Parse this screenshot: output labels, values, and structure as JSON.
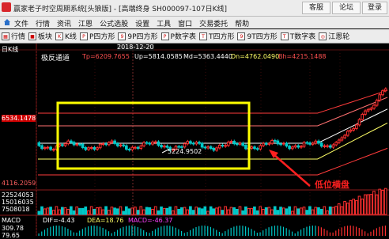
{
  "window": {
    "title": "赢家老子时空周期系统[头狼版] - [高端终身 SH000097-107日K线]",
    "buttons": [
      "客服",
      "论坛",
      "登录"
    ]
  },
  "menu": [
    "文件",
    "行情",
    "资讯",
    "江恩",
    "公式选股",
    "设置",
    "工具",
    "窗口",
    "交易委托",
    "帮助"
  ],
  "toolbar": [
    "行情",
    "板块",
    "K线",
    "P四方形",
    "9P四方形",
    "P数字表",
    "T四方形",
    "9T四方形",
    "T数字表",
    "江恩轮"
  ],
  "panel": {
    "label": "日K线",
    "indicator_name": "极反通道",
    "tp": "Tp=6209.7655",
    "up": "Up=5814.0585",
    "md": "Md=5363.4440",
    "dn": "Dn=4762.0490",
    "bh": "Bh=4215.1488",
    "date_marker": "2018-12-20",
    "price_left_high": "6534.1478",
    "price_left_low": "4116.2059",
    "point_label": "5224.9502",
    "annotation": "低位横盘",
    "vol_labels": [
      "22524053",
      "15016035",
      "7508018"
    ],
    "macd_dif": "DIF=-4.43",
    "macd_dea": "DEA=18.76",
    "macd_val": "MACD=-46.37",
    "macd_axis": [
      "309.78",
      "79.65"
    ],
    "macd_name": "MACD"
  },
  "colors": {
    "up": "#ff3030",
    "down": "#00c8c8",
    "box": "#ffff00",
    "arrow": "#ff2020"
  }
}
